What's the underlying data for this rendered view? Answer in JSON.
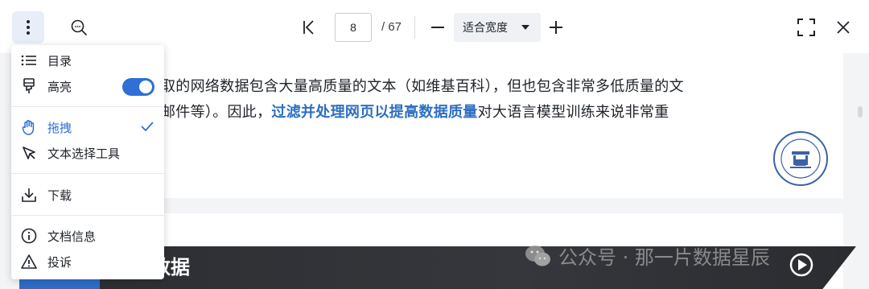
{
  "toolbar": {
    "more_icon": "more-vertical-icon",
    "search_icon": "search-icon",
    "first_page_icon": "first-page-icon",
    "current_page": "8",
    "total_pages": "/ 67",
    "zoom_out_icon": "minus-icon",
    "zoom_mode": "适合宽度",
    "zoom_in_icon": "plus-icon",
    "fullscreen_icon": "fullscreen-icon",
    "close_icon": "close-icon"
  },
  "menu": {
    "items": [
      {
        "label": "目录",
        "icon": "list-icon"
      },
      {
        "label": "高亮",
        "icon": "highlighter-icon",
        "toggle_on": true
      },
      {
        "label": "拖拽",
        "icon": "hand-icon",
        "selected": true
      },
      {
        "label": "文本选择工具",
        "icon": "cursor-icon"
      },
      {
        "label": "下载",
        "icon": "download-icon"
      },
      {
        "label": "文档信息",
        "icon": "info-icon"
      },
      {
        "label": "投诉",
        "icon": "warning-icon"
      }
    ]
  },
  "document": {
    "line1": "取的网络数据包含大量高质量的文本（如维基百科），但也包含非常多低质量的文",
    "line2_pre": "邮件等）。因此，",
    "line2_highlight": "过滤并处理网页以提高数据质量",
    "line2_post": "对大语言模型训练来说非常重",
    "banner_text": "数据",
    "watermark": "公众号 · 那一片数据星辰"
  },
  "colors": {
    "accent": "#2f6fd6",
    "highlight_text": "#2c6fc2",
    "banner": "#2b2d31"
  }
}
